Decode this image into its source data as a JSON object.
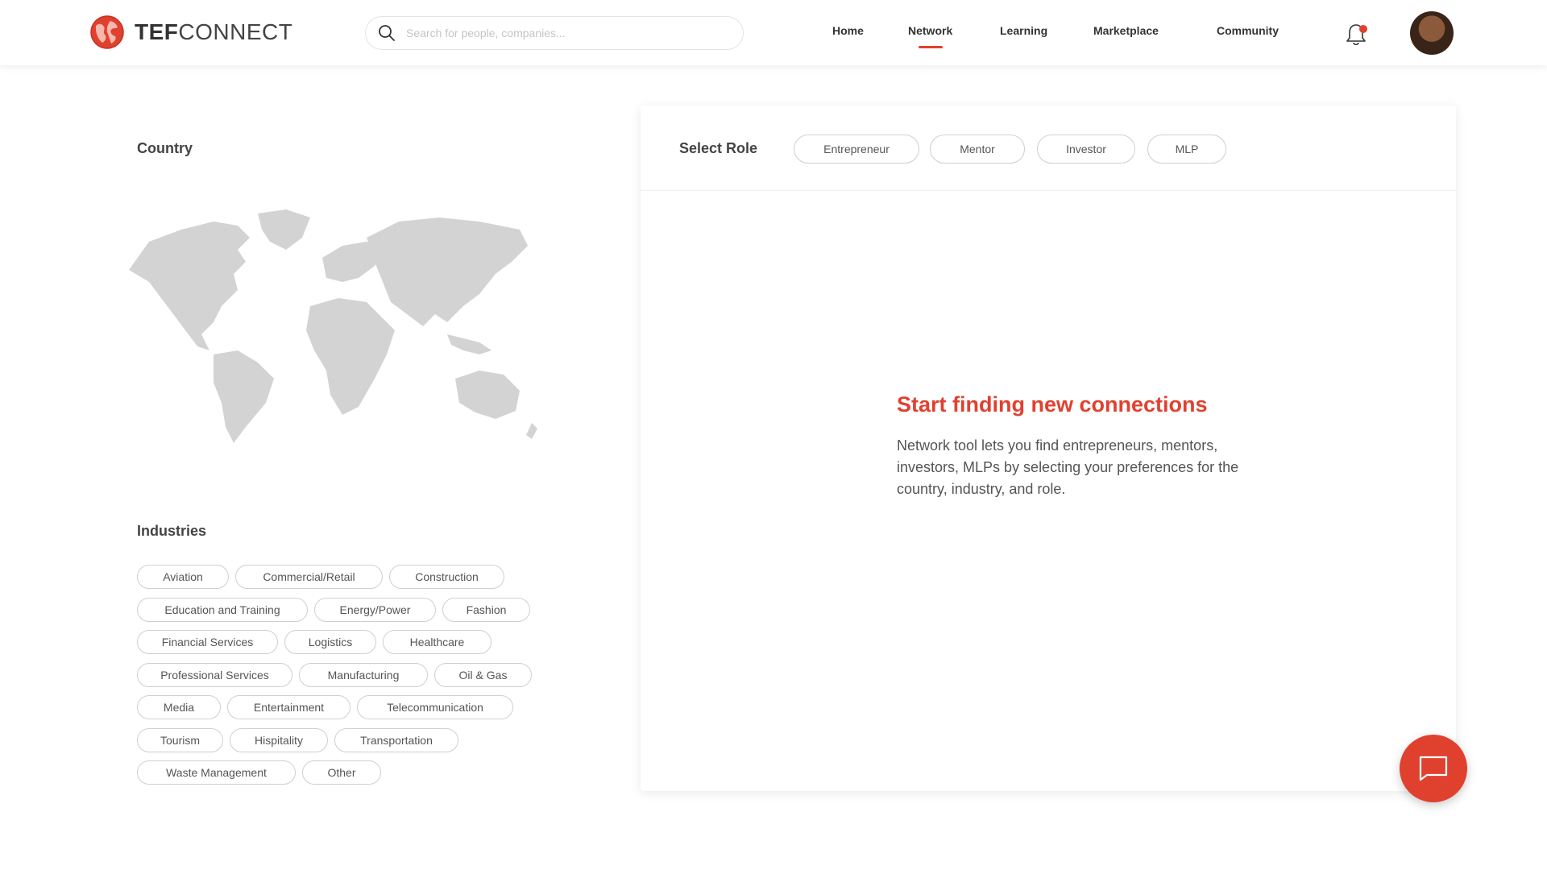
{
  "brand": {
    "bold": "TEF",
    "light": "CONNECT",
    "accent_color": "#e0412f"
  },
  "search": {
    "placeholder": "Search for people, companies..."
  },
  "nav": {
    "items": [
      {
        "label": "Home",
        "active": false
      },
      {
        "label": "Network",
        "active": true
      },
      {
        "label": "Learning",
        "active": false
      },
      {
        "label": "Marketplace",
        "active": false
      },
      {
        "label": "Community",
        "active": false
      }
    ]
  },
  "icons": {
    "search": "search-icon",
    "notifications": "bell-icon",
    "chat": "chat-icon",
    "map": "world-map"
  },
  "country": {
    "title": "Country"
  },
  "industries": {
    "title": "Industries",
    "rows": [
      [
        "Aviation",
        "Commercial/Retail",
        "Construction"
      ],
      [
        "Education and Training",
        "Energy/Power",
        "Fashion"
      ],
      [
        "Financial Services",
        "Logistics",
        "Healthcare"
      ],
      [
        "Professional Services",
        "Manufacturing",
        "Oil & Gas"
      ],
      [
        "Media",
        "Entertainment",
        "Telecommunication"
      ],
      [
        "Tourism",
        "Hispitality",
        "Transportation"
      ],
      [
        "Waste Management",
        "Other"
      ]
    ]
  },
  "role": {
    "title": "Select Role",
    "options": [
      "Entrepreneur",
      "Mentor",
      "Investor",
      "MLP"
    ]
  },
  "empty_state": {
    "title": "Start finding new connections",
    "text": "Network tool lets you find entrepreneurs, mentors, investors, MLPs by selecting your preferences for the country, industry, and role."
  }
}
